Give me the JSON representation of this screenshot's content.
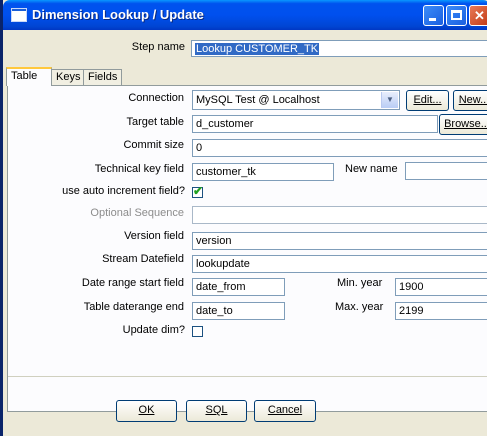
{
  "window": {
    "title": "Dimension Lookup / Update"
  },
  "step": {
    "label": "Step name",
    "value": "Lookup CUSTOMER_TK"
  },
  "tabs": [
    {
      "label": "Table",
      "active": true
    },
    {
      "label": "Keys",
      "active": false
    },
    {
      "label": "Fields",
      "active": false
    }
  ],
  "form": {
    "connection": {
      "label": "Connection",
      "value": "MySQL Test @ Localhost",
      "edit_label": "Edit...",
      "new_label": "New..."
    },
    "target_table": {
      "label": "Target table",
      "value": "d_customer",
      "browse_label": "Browse..."
    },
    "commit_size": {
      "label": "Commit size",
      "value": "0"
    },
    "technical_key": {
      "label": "Technical key field",
      "value": "customer_tk",
      "new_name_label": "New name",
      "new_name_value": ""
    },
    "auto_increment": {
      "label": "use auto increment field?",
      "checked": true
    },
    "optional_sequence": {
      "label": "Optional Sequence",
      "value": ""
    },
    "version_field": {
      "label": "Version field",
      "value": "version"
    },
    "stream_datefield": {
      "label": "Stream Datefield",
      "value": "lookupdate"
    },
    "date_range_start": {
      "label": "Date range start field",
      "value": "date_from",
      "min_year_label": "Min. year",
      "min_year_value": "1900"
    },
    "table_daterange_end": {
      "label": "Table daterange end",
      "value": "date_to",
      "max_year_label": "Max. year",
      "max_year_value": "2199"
    },
    "update_dim": {
      "label": "Update dim?",
      "checked": false
    }
  },
  "buttons": {
    "ok": "OK",
    "sql": "SQL",
    "cancel": "Cancel"
  },
  "colors": {
    "titlebar": "#0053ee",
    "selection": "#316ac5",
    "dialog_bg": "#ece9d8",
    "check": "#21a121"
  }
}
